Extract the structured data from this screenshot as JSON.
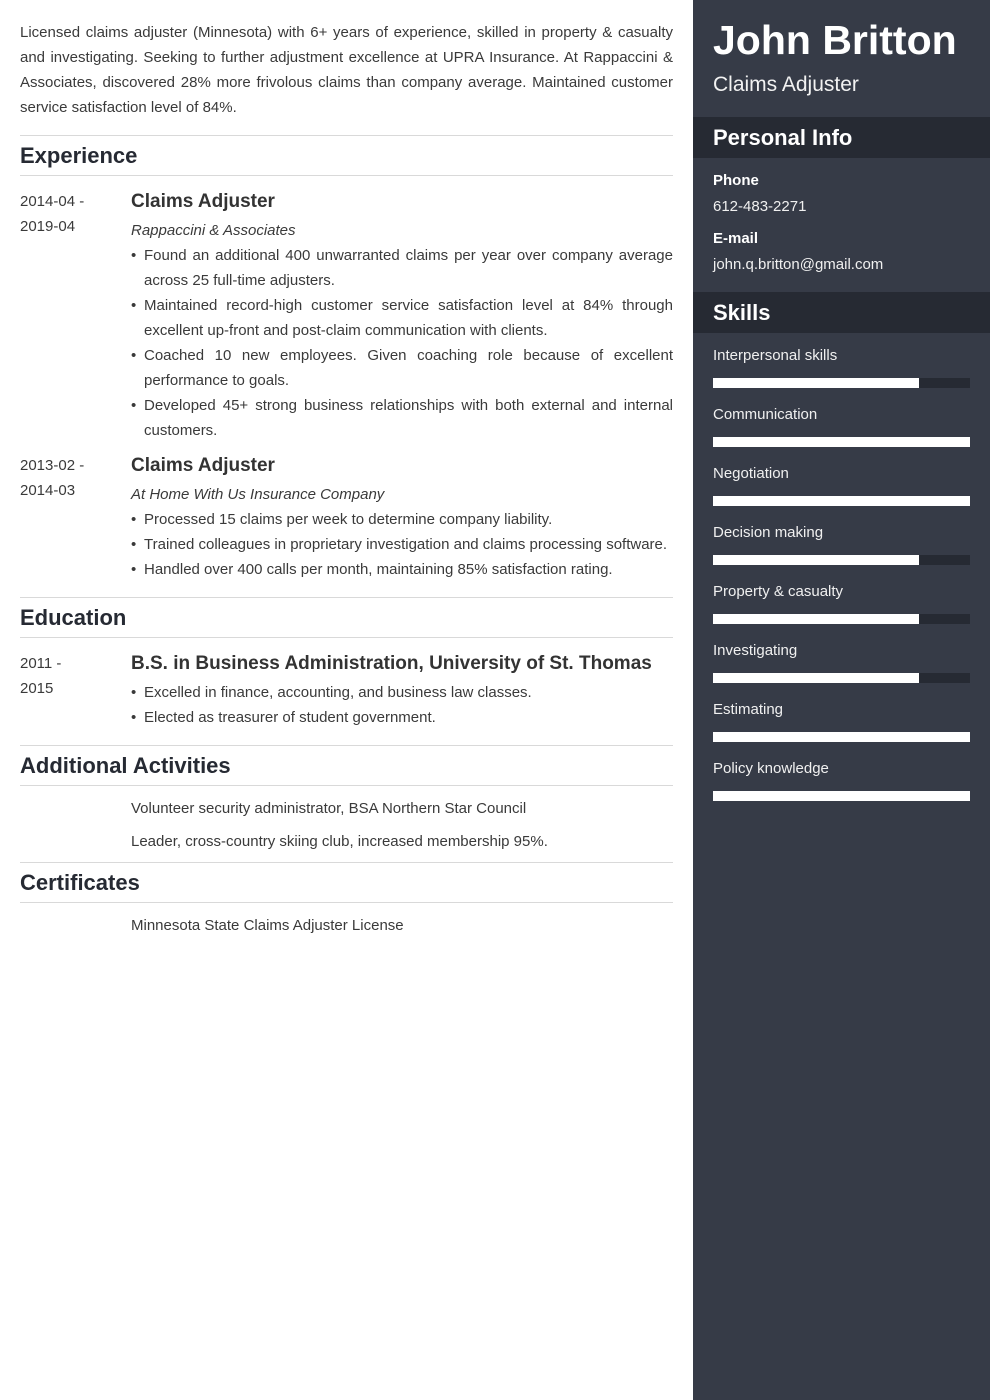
{
  "summary": "Licensed claims adjuster (Minnesota) with 6+ years of experience, skilled in property & casualty and investigating. Seeking to further adjustment excellence at UPRA Insurance. At Rappaccini & Associates, discovered 28% more frivolous claims than company average. Maintained customer service satisfaction level of 84%.",
  "sections": {
    "experience": "Experience",
    "education": "Education",
    "activities": "Additional Activities",
    "certificates": "Certificates"
  },
  "experience": [
    {
      "date_start": "2014-04 -",
      "date_end": "2019-04",
      "title": "Claims Adjuster",
      "company": "Rappaccini & Associates",
      "bullets": [
        "Found an additional 400 unwarranted claims per year over company average across 25 full-time adjusters.",
        "Maintained record-high customer service satisfaction level at 84% through excellent up-front and post-claim communication with clients.",
        "Coached 10 new employees. Given coaching role because of excellent performance to goals.",
        "Developed 45+ strong business relationships with both external and internal customers."
      ]
    },
    {
      "date_start": "2013-02 -",
      "date_end": "2014-03",
      "title": "Claims Adjuster",
      "company": "At Home With Us Insurance Company",
      "bullets": [
        "Processed 15 claims per week to determine company liability.",
        "Trained colleagues in proprietary investigation and claims processing software.",
        "Handled over 400 calls per month, maintaining 85% satisfaction rating."
      ]
    }
  ],
  "education": [
    {
      "date_start": "2011 -",
      "date_end": "2015",
      "title": "B.S. in Business Administration, University of St. Thomas",
      "bullets": [
        "Excelled in finance, accounting, and business law classes.",
        "Elected as treasurer of student government."
      ]
    }
  ],
  "activities": [
    "Volunteer security administrator, BSA Northern Star Council",
    "Leader, cross-country skiing club, increased membership 95%."
  ],
  "certificates": [
    "Minnesota State Claims Adjuster License"
  ],
  "sidebar": {
    "name": "John Britton",
    "role": "Claims Adjuster",
    "personal_info_title": "Personal Info",
    "phone_label": "Phone",
    "phone": "612-483-2271",
    "email_label": "E-mail",
    "email": "john.q.britton@gmail.com",
    "skills_title": "Skills",
    "skills": [
      {
        "name": "Interpersonal skills",
        "level": 0.8
      },
      {
        "name": "Communication",
        "level": 1.0
      },
      {
        "name": "Negotiation",
        "level": 1.0
      },
      {
        "name": "Decision making",
        "level": 0.8
      },
      {
        "name": "Property & casualty",
        "level": 0.8
      },
      {
        "name": "Investigating",
        "level": 0.8
      },
      {
        "name": "Estimating",
        "level": 1.0
      },
      {
        "name": "Policy knowledge",
        "level": 1.0
      }
    ]
  },
  "colors": {
    "sidebar_bg": "#363b47",
    "sidebar_header_bg": "#262a33",
    "heading_text": "#262a33"
  }
}
